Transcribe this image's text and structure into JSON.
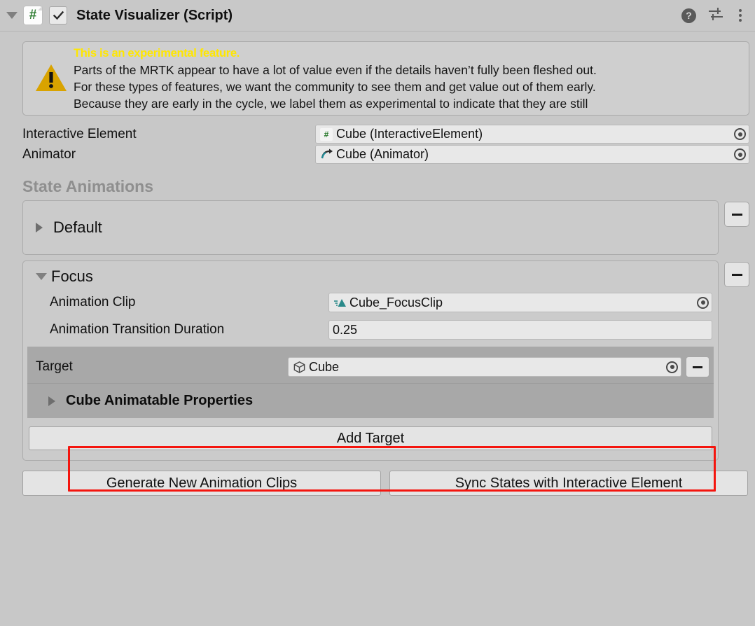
{
  "header": {
    "foldout_icon": "chevron-down-icon",
    "script_icon_glyph": "#",
    "enabled_checkbox": true,
    "title": "State Visualizer (Script)",
    "help_icon": "help-icon",
    "help_glyph": "?",
    "preset_icon": "preset-sliders-icon",
    "menu_icon": "kebab-menu-icon"
  },
  "helpbox": {
    "icon": "warning-triangle-icon",
    "title": "This is an experimental feature.",
    "line1": "Parts of the MRTK appear to have a lot of value even if the details haven’t fully been fleshed out.",
    "line2": "For these types of features, we want the community to see them and get value out of them early.",
    "line3": "Because they are early in the cycle, we label them as experimental to indicate that they are still"
  },
  "fields": {
    "interactive_element": {
      "label": "Interactive Element",
      "value": "Cube (InteractiveElement)",
      "icon": "script-component-icon"
    },
    "animator": {
      "label": "Animator",
      "value": "Cube (Animator)",
      "icon": "animator-icon"
    }
  },
  "state_animations": {
    "title": "State Animations",
    "remove_label": "−",
    "states": [
      {
        "name": "Default",
        "expanded": false,
        "foldout_icon": "chevron-right-icon"
      },
      {
        "name": "Focus",
        "expanded": true,
        "foldout_icon": "chevron-down-icon",
        "animation_clip": {
          "label": "Animation Clip",
          "value": "Cube_FocusClip",
          "icon": "animation-clip-icon"
        },
        "transition_duration": {
          "label": "Animation Transition Duration",
          "value": "0.25"
        },
        "target": {
          "label": "Target",
          "value": "Cube",
          "icon": "gameobject-cube-icon",
          "highlighted": true
        },
        "animatable_properties": {
          "label": "Cube Animatable Properties",
          "expanded": false,
          "foldout_icon": "chevron-right-icon"
        },
        "add_target_label": "Add Target"
      }
    ]
  },
  "footer": {
    "generate_label": "Generate New Animation Clips",
    "sync_label": "Sync States with Interactive Element"
  },
  "colors": {
    "background": "#c8c8c8",
    "panel": "#cbcbcb",
    "target_panel": "#a8a8a8",
    "field": "#e8e8e8",
    "warning_title": "#ffe700",
    "warning_icon": "#d9a300",
    "script_green": "#2f7d32",
    "clip_teal": "#2a8a8a",
    "highlight_red": "#f4150e",
    "section_title": "#8f8f8f"
  }
}
